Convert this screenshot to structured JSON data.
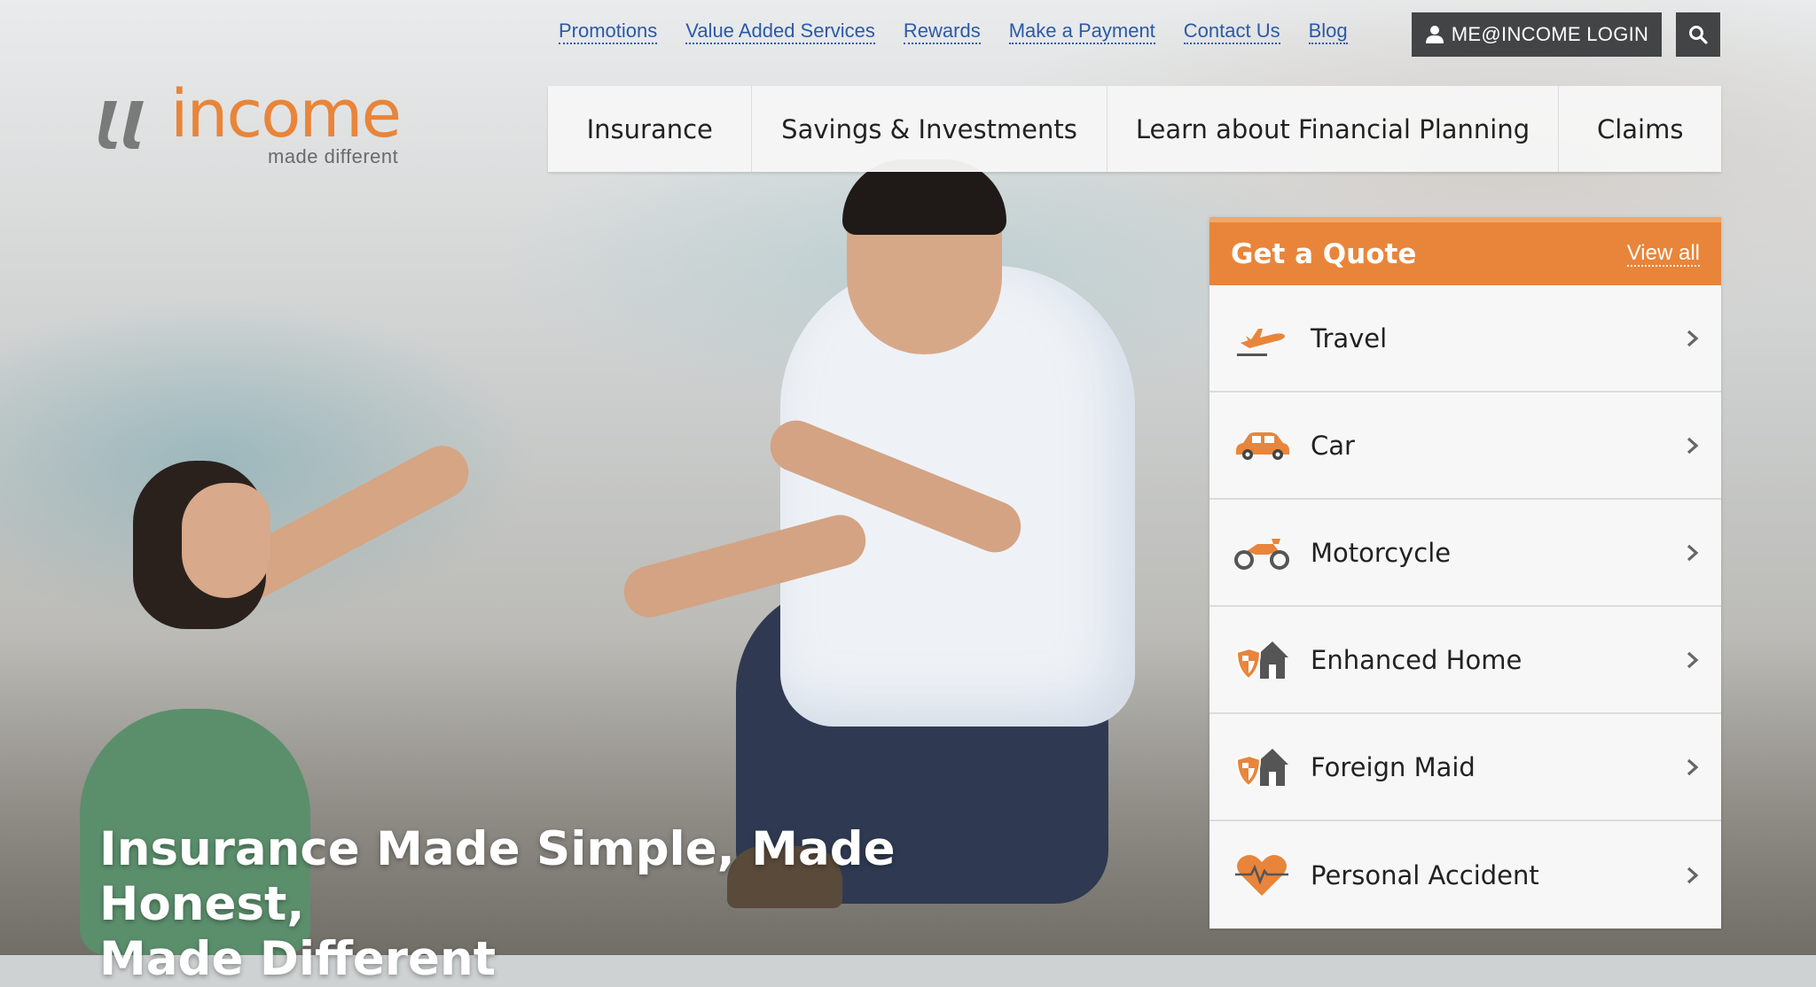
{
  "utility_nav": {
    "links": [
      "Promotions",
      "Value Added Services",
      "Rewards",
      "Make a Payment",
      "Contact Us",
      "Blog"
    ],
    "login_label": "ME@INCOME LOGIN"
  },
  "logo": {
    "word": "income",
    "tagline": "made different"
  },
  "main_nav": {
    "items": [
      "Insurance",
      "Savings & Investments",
      "Learn about Financial Planning",
      "Claims"
    ]
  },
  "quote": {
    "title": "Get a Quote",
    "view_all": "View all",
    "items": [
      {
        "label": "Travel",
        "icon": "plane-icon"
      },
      {
        "label": "Car",
        "icon": "car-icon"
      },
      {
        "label": "Motorcycle",
        "icon": "motorcycle-icon"
      },
      {
        "label": "Enhanced Home",
        "icon": "home-shield-icon"
      },
      {
        "label": "Foreign Maid",
        "icon": "home-shield-icon"
      },
      {
        "label": "Personal Accident",
        "icon": "heart-pulse-icon"
      }
    ]
  },
  "hero": {
    "headline_line1": "Insurance Made Simple, Made Honest,",
    "headline_line2": "Made Different"
  },
  "colors": {
    "brand_orange": "#e8853a",
    "link_blue": "#2a5aa8",
    "dark_button": "#434446"
  }
}
